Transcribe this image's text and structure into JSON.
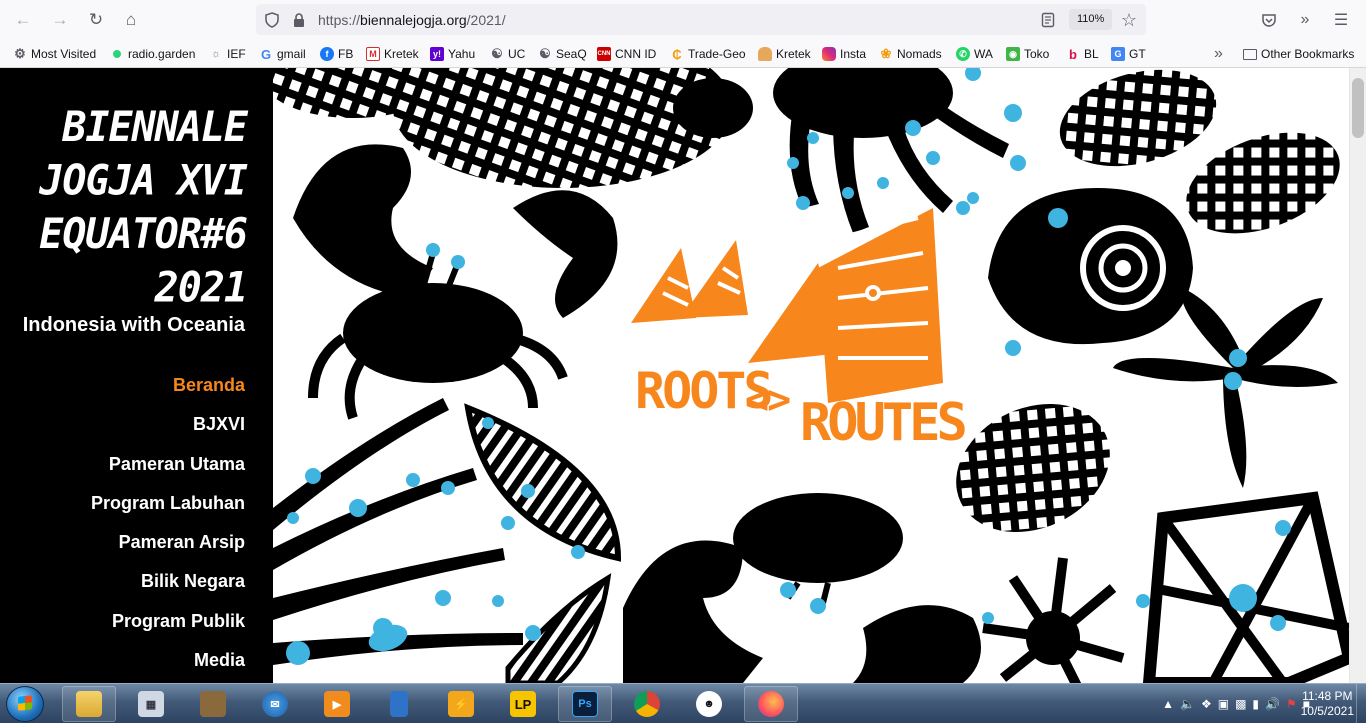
{
  "browser": {
    "url_prefix": "https://",
    "url_host": "biennalejogja.org",
    "url_path": "/2021/",
    "zoom": "110%"
  },
  "bookmarks": [
    {
      "label": "Most Visited",
      "color": "#5b5b66",
      "icon": "gear-icon"
    },
    {
      "label": "radio.garden",
      "color": "#2bd37a",
      "icon": "dot-icon"
    },
    {
      "label": "IEF",
      "color": "#888888",
      "icon": "ief-icon"
    },
    {
      "label": "gmail",
      "color": "#4285f4",
      "icon": "google-icon"
    },
    {
      "label": "FB",
      "color": "#1877f2",
      "icon": "facebook-icon"
    },
    {
      "label": "Kretek",
      "color": "#d32f2f",
      "icon": "kretek-icon"
    },
    {
      "label": "Yahu",
      "color": "#6001d2",
      "icon": "yahoo-icon"
    },
    {
      "label": "UC",
      "color": "#5b5b66",
      "icon": "globe-icon"
    },
    {
      "label": "SeaQ",
      "color": "#5b5b66",
      "icon": "globe-icon"
    },
    {
      "label": "CNN ID",
      "color": "#cc0000",
      "icon": "cnn-icon"
    },
    {
      "label": "Trade-Geo",
      "color": "#f39c12",
      "icon": "trade-icon"
    },
    {
      "label": "Kretek",
      "color": "#e67e22",
      "icon": "burger-icon"
    },
    {
      "label": "Insta",
      "color": "#c13584",
      "icon": "instagram-icon"
    },
    {
      "label": "Nomads",
      "color": "#f39c12",
      "icon": "nomads-icon"
    },
    {
      "label": "WA",
      "color": "#25d366",
      "icon": "whatsapp-icon"
    },
    {
      "label": "Toko",
      "color": "#42b549",
      "icon": "toko-icon"
    },
    {
      "label": "BL",
      "color": "#d71149",
      "icon": "bl-icon"
    },
    {
      "label": "GT",
      "color": "#4285f4",
      "icon": "translate-icon"
    }
  ],
  "other_bookmarks": "Other Bookmarks",
  "sidebar": {
    "logo_lines": [
      "BIENNALE",
      "JOGJA XVI",
      "EQUATOR#6",
      "2021"
    ],
    "tagline": "Indonesia with Oceania",
    "menu": [
      {
        "label": "Beranda",
        "active": true
      },
      {
        "label": "BJXVI",
        "active": false
      },
      {
        "label": "Pameran Utama",
        "active": false
      },
      {
        "label": "Program Labuhan",
        "active": false
      },
      {
        "label": "Pameran Arsip",
        "active": false
      },
      {
        "label": "Bilik Negara",
        "active": false
      },
      {
        "label": "Program Publik",
        "active": false
      },
      {
        "label": "Media",
        "active": false
      }
    ]
  },
  "hero": {
    "word_left": "ROOTS",
    "connector": "<>",
    "word_right": "ROUTES",
    "accent": "#f7861d",
    "spot": "#3fb4e0"
  },
  "taskbar": {
    "clock_time": "11:48 PM",
    "clock_date": "10/5/2021"
  }
}
